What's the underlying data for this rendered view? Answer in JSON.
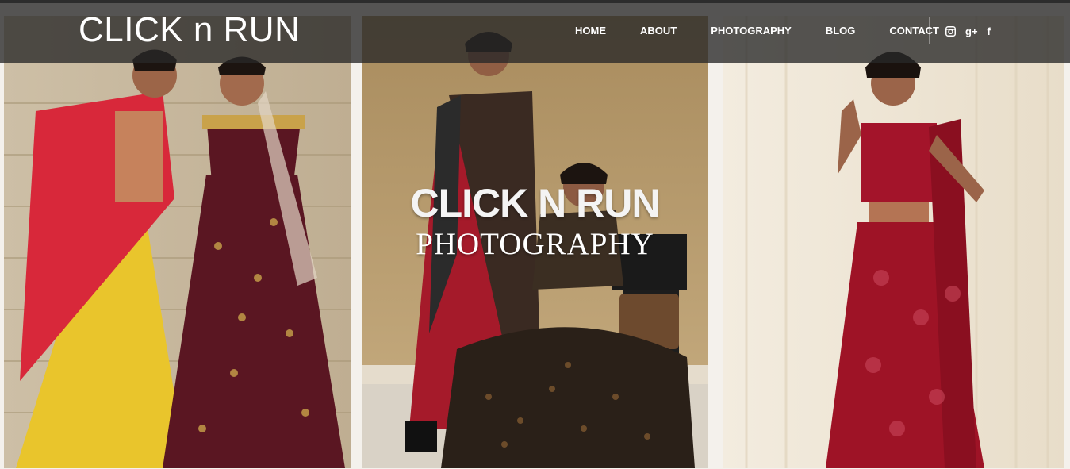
{
  "header": {
    "logo": "CLICK n RUN",
    "nav": [
      "HOME",
      "ABOUT",
      "PHOTOGRAPHY",
      "BLOG",
      "CONTACT"
    ],
    "social": [
      {
        "icon": "instagram-icon",
        "glyph": "◙"
      },
      {
        "icon": "google-plus-icon",
        "glyph": "g+"
      },
      {
        "icon": "facebook-icon",
        "glyph": "f"
      }
    ]
  },
  "hero": {
    "title": "CLICK N RUN",
    "subtitle": "PHOTOGRAPHY"
  },
  "gallery": {
    "photos": [
      {
        "icon": "photo-two-models-lehenga"
      },
      {
        "icon": "photo-two-models-chair"
      },
      {
        "icon": "photo-model-red-saree"
      }
    ]
  },
  "colors": {
    "navbar": "#282828",
    "text": "#ffffff"
  }
}
